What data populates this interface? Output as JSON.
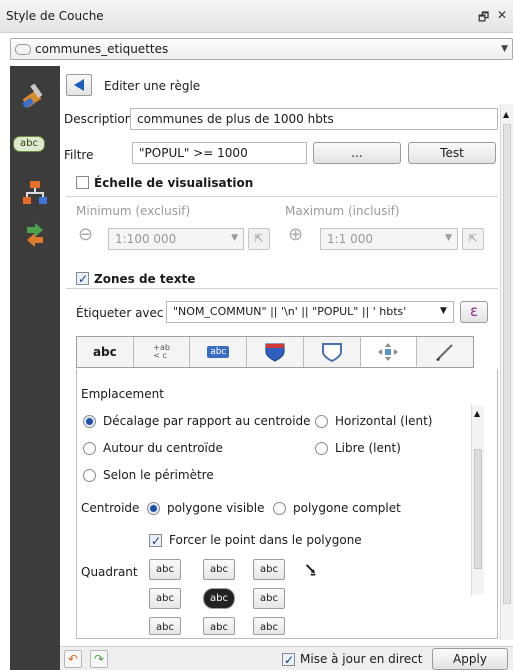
{
  "window": {
    "title": "Style de Couche",
    "float_icon": "restore-icon",
    "close_icon": "close-icon",
    "float_glyph": "🗗",
    "close_glyph": "✕"
  },
  "layer_select": {
    "value": "communes_etiquettes"
  },
  "rule": {
    "header": "Editer une règle",
    "description_label": "Description",
    "description_value": "communes de plus de 1000 hbts",
    "filter_label": "Filtre",
    "filter_value": "\"POPUL\" >= 1000",
    "filter_button": "...",
    "test_button": "Test"
  },
  "scale": {
    "title": "Échelle de visualisation",
    "min_label": "Minimum (exclusif)",
    "max_label": "Maximum (inclusif)",
    "min_value": "1:100 000",
    "max_value": "1:1 000"
  },
  "labels": {
    "title": "Zones de texte",
    "label_with": "Étiqueter avec",
    "expression": "\"NOM_COMMUN\" || '\\n' || \"POPUL\" || ' hbts'",
    "epsilon": "ε"
  },
  "tabs": [
    {
      "text": "abc",
      "icon": "text-icon"
    },
    {
      "text": "+ab\n< c",
      "icon": "formatting-icon"
    },
    {
      "text": "abc",
      "icon": "buffer-icon"
    },
    {
      "text": "",
      "icon": "background-shield-icon"
    },
    {
      "text": "",
      "icon": "shadow-icon"
    },
    {
      "text": "",
      "icon": "placement-icon"
    },
    {
      "text": "",
      "icon": "rendering-icon"
    }
  ],
  "placement": {
    "section": "Emplacement",
    "options": {
      "offset_centroid": "Décalage par rapport au centroide",
      "horizontal": "Horizontal (lent)",
      "around_centroid": "Autour du centroïde",
      "free": "Libre (lent)",
      "perimeter": "Selon le périmètre"
    },
    "centroid_label": "Centroide",
    "visible_polygon": "polygone visible",
    "whole_polygon": "polygone complet",
    "force_inside": "Forcer le point dans le polygone",
    "quadrant_label": "Quadrant",
    "quadrant_text": "abc"
  },
  "footer": {
    "live_update": "Mise à jour en direct",
    "apply": "Apply"
  }
}
